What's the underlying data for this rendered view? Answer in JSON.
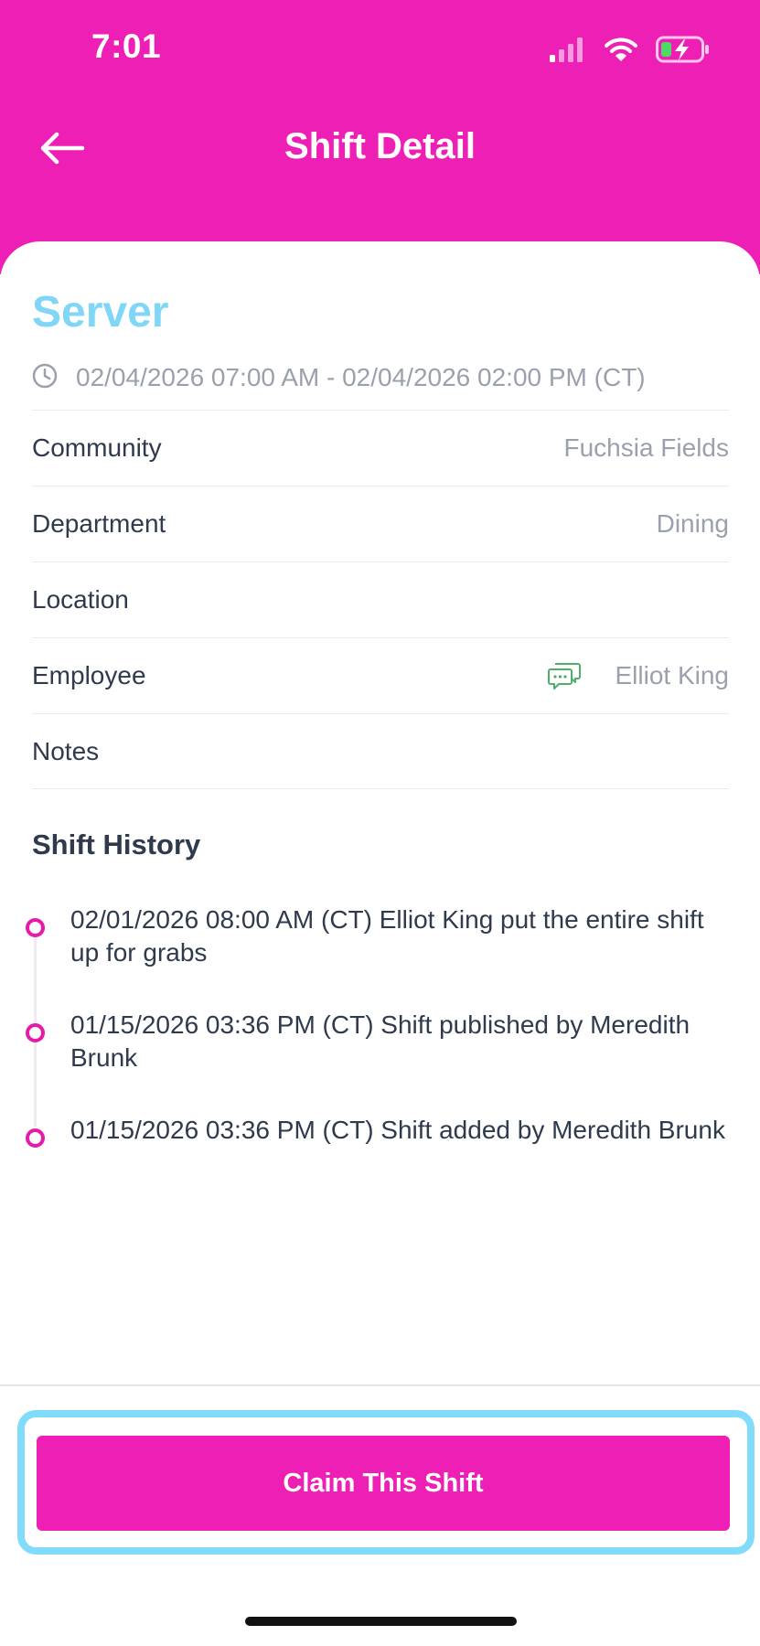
{
  "status_bar": {
    "time": "7:01",
    "icons": [
      "signal-icon",
      "wifi-icon",
      "battery-charging-icon"
    ]
  },
  "header": {
    "title": "Shift Detail",
    "back_icon": "arrow-left-icon"
  },
  "shift": {
    "role": "Server",
    "datetime": "02/04/2026 07:00 AM - 02/04/2026 02:00 PM (CT)",
    "details": [
      {
        "label": "Community",
        "value": "Fuchsia Fields"
      },
      {
        "label": "Department",
        "value": "Dining"
      },
      {
        "label": "Location",
        "value": ""
      },
      {
        "label": "Employee",
        "value": "Elliot King"
      },
      {
        "label": "Notes",
        "value": ""
      }
    ]
  },
  "history": {
    "title": "Shift History",
    "items": [
      {
        "text": "02/01/2026 08:00 AM (CT) Elliot King put the entire shift up for grabs"
      },
      {
        "text": "01/15/2026 03:36 PM (CT) Shift published by Meredith Brunk"
      },
      {
        "text": "01/15/2026 03:36 PM (CT) Shift added by Meredith Brunk"
      }
    ]
  },
  "actions": {
    "claim_label": "Claim This Shift"
  },
  "colors": {
    "brand": "#ee1fb5",
    "role_title": "#7fd6f7",
    "highlight_border": "#81dcfb",
    "chat_icon": "#4caf6a",
    "timeline_dot": "#e51ca8"
  }
}
